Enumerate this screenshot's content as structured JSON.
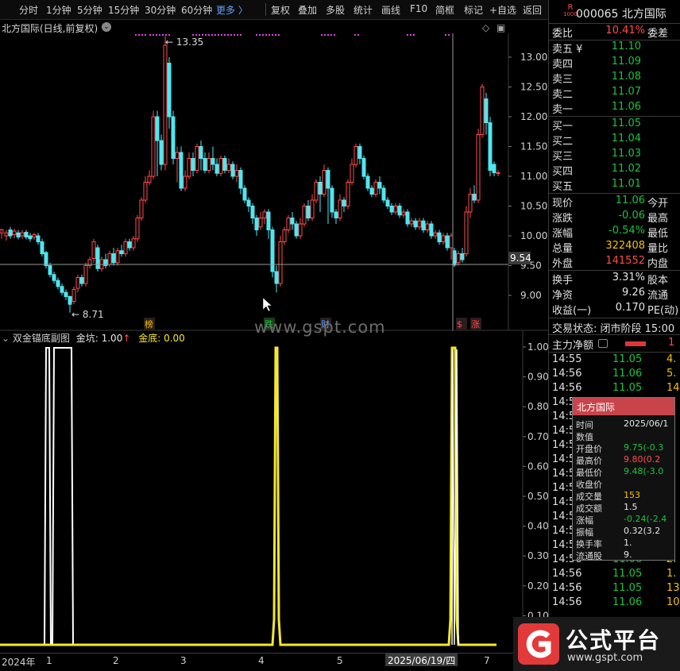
{
  "toolbar": {
    "periods": [
      "分时",
      "1分钟",
      "5分钟",
      "15分钟",
      "30分钟",
      "60分钟"
    ],
    "more_label": "更多 〉",
    "tools": [
      "复权",
      "叠加",
      "多股",
      "统计",
      "画线",
      "F10",
      "简框",
      "标记",
      "+自选",
      "返回"
    ]
  },
  "main_chart": {
    "title": "北方国际(日线,前复权)",
    "high_label": "13.35",
    "low_label": "8.71",
    "cursor_price": "9.54",
    "price_ticks": [
      "13.00",
      "12.50",
      "12.00",
      "11.50",
      "11.00",
      "10.50",
      "10.00",
      "9.50",
      "9.00"
    ],
    "markers": [
      {
        "text": "榜",
        "color": "#f4c000"
      },
      {
        "text": "跌",
        "color": "#19c53b"
      },
      {
        "text": "财",
        "color": "#5fa3ff"
      },
      {
        "text": "$",
        "color": "#ff4b4b"
      },
      {
        "text": "涨",
        "color": "#ff4b4b"
      }
    ]
  },
  "watermark": "www.gspt.com",
  "sub_chart": {
    "title": "双金锚底副图",
    "label_a": "金坑:",
    "value_a": "1.00",
    "arrow_a": "↑",
    "label_b": "金底:",
    "value_b": "0.00",
    "ticks": [
      "1.00",
      "0.90",
      "0.80",
      "0.70",
      "0.60",
      "0.50",
      "0.40",
      "0.30",
      "0.20",
      "0.10"
    ]
  },
  "x_axis": {
    "labels": [
      "2024年",
      "1",
      "2",
      "3",
      "4",
      "5",
      "7"
    ],
    "cursor_date": "2025/06/19/四"
  },
  "quote": {
    "badge_top": "R",
    "badge_bottom": "1000",
    "code": "000065 北方国际",
    "ratio_label": "委比",
    "ratio_value": "10.41%",
    "ratio_right": "委差",
    "asks": [
      {
        "label": "卖五 ¥",
        "price": "11.10"
      },
      {
        "label": "卖四",
        "price": "11.09"
      },
      {
        "label": "卖三",
        "price": "11.08"
      },
      {
        "label": "卖二",
        "price": "11.07"
      },
      {
        "label": "卖一",
        "price": "11.06"
      }
    ],
    "bids": [
      {
        "label": "买一",
        "price": "11.05"
      },
      {
        "label": "买二",
        "price": "11.04"
      },
      {
        "label": "买三",
        "price": "11.03"
      },
      {
        "label": "买四",
        "price": "11.02"
      },
      {
        "label": "买五",
        "price": "11.01"
      }
    ],
    "stats": [
      {
        "label": "现价",
        "value": "11.06",
        "color": "green",
        "right": "今开"
      },
      {
        "label": "涨跌",
        "value": "-0.06",
        "color": "green",
        "right": "最高"
      },
      {
        "label": "涨幅",
        "value": "-0.54%",
        "color": "green",
        "right": "最低"
      },
      {
        "label": "总量",
        "value": "322408",
        "color": "yellow",
        "right": "量比"
      },
      {
        "label": "外盘",
        "value": "141552",
        "color": "red",
        "right": "内盘"
      }
    ],
    "stats2": [
      {
        "label": "换手",
        "value": "3.31%",
        "right": "股本"
      },
      {
        "label": "净资",
        "value": "9.26",
        "right": "流通"
      },
      {
        "label": "收益(一)",
        "value": "0.170",
        "right": "PE(动)"
      }
    ],
    "status": "交易状态: 闭市阶段 15:00",
    "main_flow_label": "主力净额",
    "main_flow_value": "1",
    "ticks": [
      {
        "time": "14:55",
        "price": "11.05",
        "vol": "4."
      },
      {
        "time": "14:56",
        "price": "11.06",
        "vol": "5."
      },
      {
        "time": "14:56",
        "price": "11.05",
        "vol": "14."
      },
      {
        "time": "14:5",
        "price": "",
        "vol": ""
      },
      {
        "time": "14:5",
        "price": "",
        "vol": ""
      },
      {
        "time": "14:5",
        "price": "",
        "vol": ""
      },
      {
        "time": "14:5",
        "price": "",
        "vol": ""
      },
      {
        "time": "14:5",
        "price": "",
        "vol": ""
      },
      {
        "time": "14:5",
        "price": "",
        "vol": ""
      },
      {
        "time": "14:5",
        "price": "",
        "vol": ""
      },
      {
        "time": "14:5",
        "price": "",
        "vol": ""
      },
      {
        "time": "14:5",
        "price": "",
        "vol": ""
      },
      {
        "time": "14:5",
        "price": "",
        "vol": ""
      },
      {
        "time": "14:56",
        "price": "11.05",
        "vol": ""
      },
      {
        "time": "14:56",
        "price": "11.06",
        "vol": "2."
      },
      {
        "time": "14:56",
        "price": "11.05",
        "vol": "1."
      },
      {
        "time": "14:56",
        "price": "11.05",
        "vol": "13."
      },
      {
        "time": "14:56",
        "price": "11.06",
        "vol": "10."
      }
    ]
  },
  "tooltip": {
    "title": "北方国际",
    "rows": [
      {
        "k": "时间",
        "v": "2025/06/1",
        "color": "#e6e6e6"
      },
      {
        "k": "数值",
        "v": "",
        "color": "#e6e6e6"
      },
      {
        "k": "开盘价",
        "v": "9.75(-0.3",
        "color": "#19c53b"
      },
      {
        "k": "最高价",
        "v": "9.80(0.2",
        "color": "#ff4b4b"
      },
      {
        "k": "最低价",
        "v": "9.48(-3.0",
        "color": "#19c53b"
      },
      {
        "k": "收盘价",
        "v": "",
        "color": "#e6e6e6"
      },
      {
        "k": "成交量",
        "v": "153",
        "color": "#f4c000"
      },
      {
        "k": "成交额",
        "v": "1.5",
        "color": "#e6e6e6"
      },
      {
        "k": "涨幅",
        "v": "-0.24(-2.4",
        "color": "#19c53b"
      },
      {
        "k": "振幅",
        "v": "0.32(3.2",
        "color": "#e6e6e6"
      },
      {
        "k": "换手率",
        "v": "1.",
        "color": "#e6e6e6"
      },
      {
        "k": "流通股",
        "v": "9.",
        "color": "#e6e6e6"
      }
    ]
  },
  "logo": {
    "text": "公式平台",
    "url": "www.gspt.com"
  }
}
